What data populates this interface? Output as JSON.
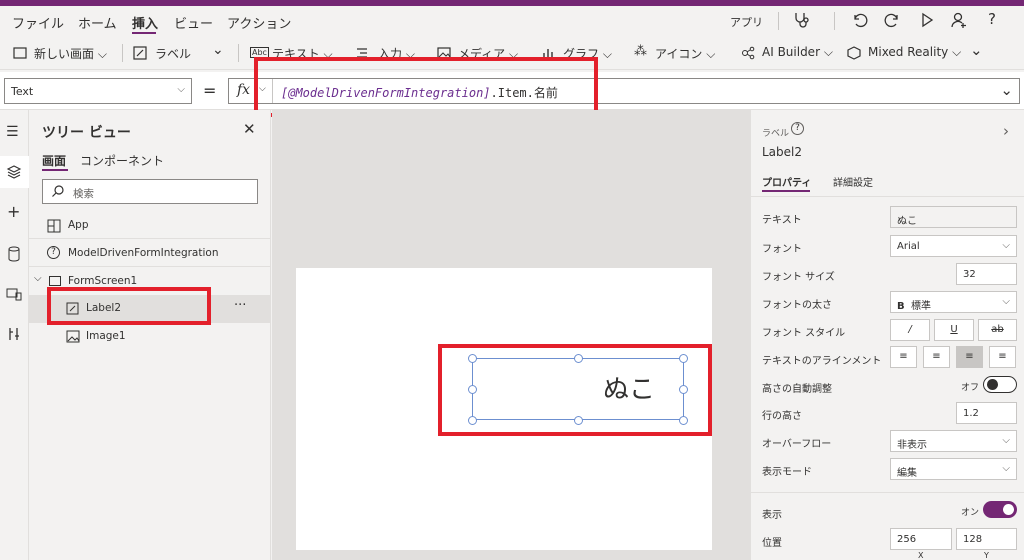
{
  "menu": {
    "file": "ファイル",
    "home": "ホーム",
    "insert": "挿入",
    "view": "ビュー",
    "action": "アクション",
    "app": "アプリ"
  },
  "toolbar": {
    "new_screen": "新しい画面",
    "label": "ラベル",
    "text": "テキスト",
    "input": "入力",
    "media": "メディア",
    "chart": "グラフ",
    "icon": "アイコン",
    "ai_builder": "AI Builder",
    "mixed_reality": "Mixed Reality"
  },
  "formula": {
    "property": "Text",
    "equals": "=",
    "fx": "fx",
    "token": "[@ModelDrivenFormIntegration]",
    "rest": ".Item.名前"
  },
  "tree": {
    "title": "ツリー ビュー",
    "tab_screens": "画面",
    "tab_components": "コンポーネント",
    "search_placeholder": "検索",
    "items": [
      {
        "label": "App"
      },
      {
        "label": "ModelDrivenFormIntegration"
      },
      {
        "label": "FormScreen1"
      },
      {
        "label": "Label2"
      },
      {
        "label": "Image1"
      }
    ],
    "more": "···"
  },
  "canvas": {
    "label_text": "ぬこ"
  },
  "props": {
    "type": "ラベル",
    "name": "Label2",
    "tab_properties": "プロパティ",
    "tab_advanced": "詳細設定",
    "text_label": "テキスト",
    "text_value": "ぬこ",
    "font_label": "フォント",
    "font_value": "Arial",
    "font_size_label": "フォント サイズ",
    "font_size_value": "32",
    "font_weight_label": "フォントの太さ",
    "font_weight_b": "B",
    "font_weight_value": "標準",
    "font_style_label": "フォント スタイル",
    "align_label": "テキストのアラインメント",
    "autoheight_label": "高さの自動調整",
    "autoheight_value": "オフ",
    "lineheight_label": "行の高さ",
    "lineheight_value": "1.2",
    "overflow_label": "オーバーフロー",
    "overflow_value": "非表示",
    "display_label": "表示モード",
    "display_value": "編集",
    "visible_label": "表示",
    "visible_value": "オン",
    "position_label": "位置",
    "pos_x": "256",
    "pos_y": "128",
    "x_caption": "X",
    "y_caption": "Y"
  },
  "colors": {
    "accent": "#742774",
    "highlight": "#e3202b"
  }
}
